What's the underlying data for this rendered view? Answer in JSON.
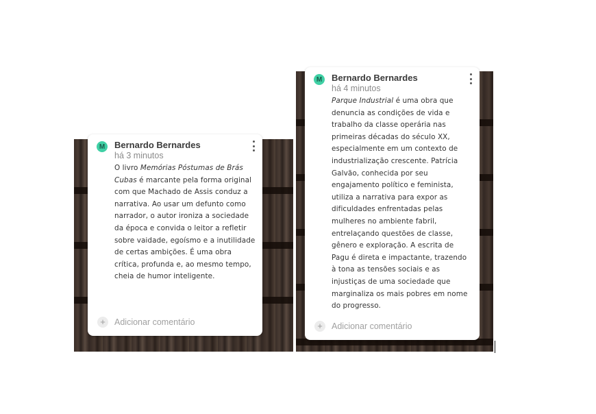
{
  "cards": [
    {
      "author": "Bernardo Bernardes",
      "avatar_letter": "M",
      "time": "há 3 minutos",
      "text_pre": "O livro ",
      "text_italic": "Memórias Póstumas de Brás Cubas",
      "text_post": " é marcante pela forma original com que Machado de Assis conduz a narrativa. Ao usar um defunto como narrador, o autor ironiza a sociedade da época e convida o leitor a refletir sobre vaidade, egoísmo e a inutilidade de certas ambições. É uma obra crítica, profunda e, ao mesmo tempo, cheia de humor inteligente.",
      "comment_placeholder": "Adicionar comentário"
    },
    {
      "author": "Bernardo Bernardes",
      "avatar_letter": "M",
      "time": "há 4 minutos",
      "text_pre": "",
      "text_italic": "Parque Industrial",
      "text_post": " é uma obra que denuncia as condições de vida e trabalho da classe operária nas primeiras décadas do século XX, especialmente em um contexto de industrialização crescente. Patrícia Galvão, conhecida por seu engajamento político e feminista, utiliza a narrativa para expor as dificuldades enfrentadas pelas mulheres no ambiente fabril, entrelaçando questões de classe, gênero e exploração. A escrita de Pagu é direta e impactante, trazendo à tona as tensões sociais e as injustiças de uma sociedade que marginaliza os mais pobres em nome do progresso.",
      "comment_placeholder": "Adicionar comentário"
    }
  ],
  "colors": {
    "avatar": "#3fd0a5",
    "shelf": "#3a2e28"
  }
}
